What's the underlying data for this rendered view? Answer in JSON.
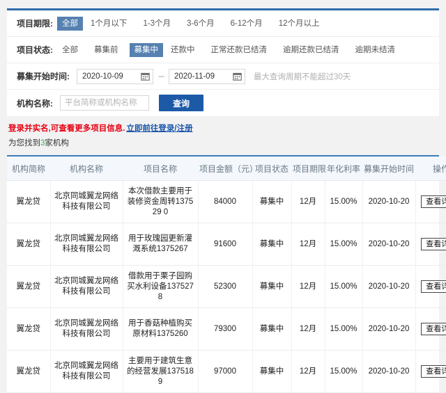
{
  "filters": {
    "term": {
      "label": "项目期限:",
      "options": [
        "全部",
        "1个月以下",
        "1-3个月",
        "3-6个月",
        "6-12个月",
        "12个月以上"
      ],
      "selected": "全部"
    },
    "status": {
      "label": "项目状态:",
      "options": [
        "全部",
        "募集前",
        "募集中",
        "还款中",
        "正常还款已结清",
        "逾期还款已结清",
        "逾期未结清"
      ],
      "selected": "募集中"
    },
    "date": {
      "label": "募集开始时间:",
      "start": "2020-10-09",
      "end": "2020-11-09",
      "separator": "---",
      "hint": "最大查询周期不能超过30天",
      "calendar_icon": "calendar-icon"
    },
    "org": {
      "label": "机构名称:",
      "placeholder": "平台简称或机构名称",
      "value": "",
      "search_label": "查询"
    }
  },
  "notice": {
    "warning": "登录并实名,可查看更多项目信息.",
    "link": "立即前往登录/注册",
    "warning_color": "#e60012",
    "link_color": "#1a55a8"
  },
  "result_summary": {
    "prefix": "为您找到",
    "count": "3",
    "suffix": "家机构",
    "count_color": "#2eae4e"
  },
  "table": {
    "columns": [
      "机构简称",
      "机构名称",
      "项目名称",
      "项目金额（元）",
      "项目状态",
      "项目期限",
      "年化利率",
      "募集开始时间",
      "操作"
    ],
    "action_label": "查看详情",
    "rows": [
      {
        "abbr": "翼龙贷",
        "org": "北京同城翼龙网络科技有限公司",
        "project": "本次借款主要用于装修资金周转137529 0",
        "amount": "84000",
        "status": "募集中",
        "term": "12月",
        "rate": "15.00%",
        "start": "2020-10-20",
        "action": "查看详情"
      },
      {
        "abbr": "翼龙贷",
        "org": "北京同城翼龙网络科技有限公司",
        "project": "用于玫瑰园更新灌溉系统1375267",
        "amount": "91600",
        "status": "募集中",
        "term": "12月",
        "rate": "15.00%",
        "start": "2020-10-20",
        "action": "查看详情"
      },
      {
        "abbr": "翼龙贷",
        "org": "北京同城翼龙网络科技有限公司",
        "project": "借款用于栗子园购买水利设备1375278",
        "amount": "52300",
        "status": "募集中",
        "term": "12月",
        "rate": "15.00%",
        "start": "2020-10-20",
        "action": "查看详情"
      },
      {
        "abbr": "翼龙贷",
        "org": "北京同城翼龙网络科技有限公司",
        "project": "用于香菇种植购买原材料1375260",
        "amount": "79300",
        "status": "募集中",
        "term": "12月",
        "rate": "15.00%",
        "start": "2020-10-20",
        "action": "查看详情"
      },
      {
        "abbr": "翼龙贷",
        "org": "北京同城翼龙网络科技有限公司",
        "project": "主要用于建筑生意的经营发展1375189",
        "amount": "97000",
        "status": "募集中",
        "term": "12月",
        "rate": "15.00%",
        "start": "2020-10-20",
        "action": "查看详情"
      }
    ]
  },
  "theme": {
    "accent": "#2f6ba8",
    "active_tag": "#5681b0",
    "button": "#1c5aa8",
    "table_header_bg": "#f4f7fb"
  }
}
